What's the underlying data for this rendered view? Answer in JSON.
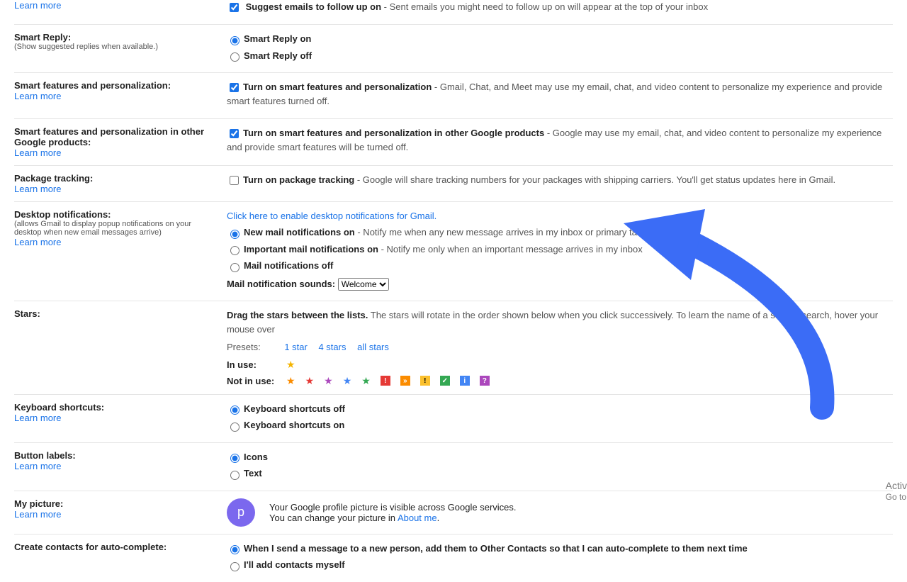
{
  "learn_more": "Learn more",
  "followup": {
    "label": "Suggest emails to follow up on",
    "desc": " - Sent emails you might need to follow up on will appear at the top of your inbox"
  },
  "smart_reply": {
    "title": "Smart Reply:",
    "sub": "(Show suggested replies when available.)",
    "on": "Smart Reply on",
    "off": "Smart Reply off"
  },
  "smart_features": {
    "title": "Smart features and personalization:",
    "opt": "Turn on smart features and personalization",
    "desc": " - Gmail, Chat, and Meet may use my email, chat, and video content to personalize my experience and provide smart features turned off."
  },
  "smart_features_other": {
    "title": "Smart features and personalization in other Google products:",
    "opt": "Turn on smart features and personalization in other Google products",
    "desc": " - Google may use my email, chat, and video content to personalize my experience and provide smart features will be turned off."
  },
  "package": {
    "title": "Package tracking:",
    "opt": "Turn on package tracking",
    "desc": " - Google will share tracking numbers for your packages with shipping carriers. You'll get status updates here in Gmail."
  },
  "notifications": {
    "title": "Desktop notifications:",
    "sub": "(allows Gmail to display popup notifications on your desktop when new email messages arrive)",
    "enable_link": "Click here to enable desktop notifications for Gmail.",
    "opt1": "New mail notifications on",
    "opt1_desc": " - Notify me when any new message arrives in my inbox or primary tab",
    "opt2": "Important mail notifications on",
    "opt2_desc": " - Notify me only when an important message arrives in my inbox",
    "opt3": "Mail notifications off",
    "sound_label": "Mail notification sounds:",
    "sound_value": "Welcome"
  },
  "stars": {
    "title": "Stars:",
    "drag": "Drag the stars between the lists.",
    "desc": "  The stars will rotate in the order shown below when you click successively. To learn the name of a star for search, hover your mouse over",
    "presets": "Presets:",
    "p1": "1 star",
    "p4": "4 stars",
    "pall": "all stars",
    "in_use": "In use:",
    "not_in_use": "Not in use:"
  },
  "shortcuts": {
    "title": "Keyboard shortcuts:",
    "off": "Keyboard shortcuts off",
    "on": "Keyboard shortcuts on"
  },
  "buttons": {
    "title": "Button labels:",
    "icons": "Icons",
    "text": "Text"
  },
  "picture": {
    "title": "My picture:",
    "initial": "p",
    "line1": "Your Google profile picture is visible across Google services.",
    "line2a": "You can change your picture in ",
    "about": "About me",
    "dot": "."
  },
  "contacts": {
    "title": "Create contacts for auto-complete:",
    "opt1": "When I send a message to a new person, add them to Other Contacts so that I can auto-complete to them next time",
    "opt2": "I'll add contacts myself"
  },
  "watermark": {
    "l1": "Activ",
    "l2": "Go to"
  }
}
